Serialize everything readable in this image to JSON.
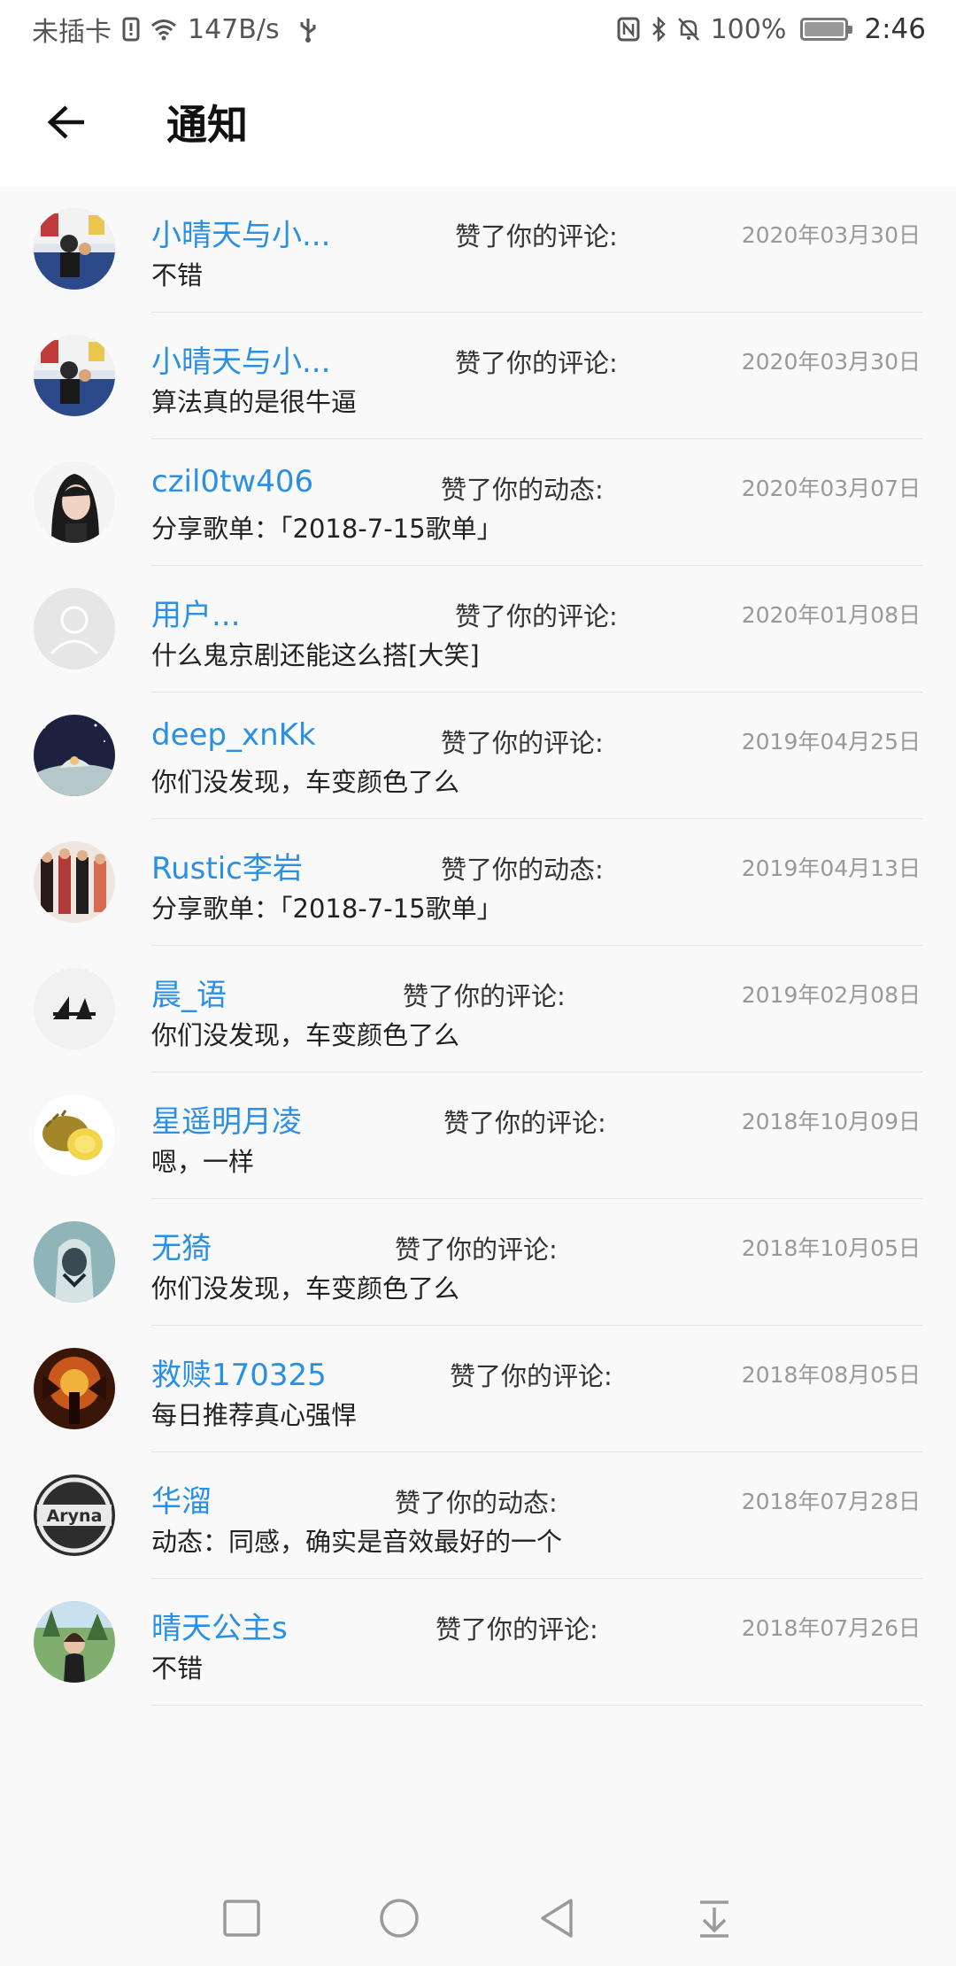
{
  "status_bar": {
    "carrier": "未插卡",
    "speed": "147B/s",
    "battery": "100%",
    "time": "2:46",
    "icons": [
      "sim-alert-icon",
      "wifi-icon",
      "usb-icon",
      "nfc-icon",
      "bluetooth-icon",
      "mute-icon",
      "battery-icon"
    ]
  },
  "header": {
    "title": "通知",
    "back_icon": "arrow-left-icon"
  },
  "notifications": [
    {
      "name": "小晴天与小...",
      "action": "赞了你的评论:",
      "date": "2020年03月30日",
      "content": "不错",
      "avatar": "photo"
    },
    {
      "name": "小晴天与小...",
      "action": "赞了你的评论:",
      "date": "2020年03月30日",
      "content": "算法真的是很牛逼",
      "avatar": "photo"
    },
    {
      "name": "czil0tw406",
      "action": "赞了你的动态:",
      "date": "2020年03月07日",
      "content": "分享歌单：「2018-7-15歌单」",
      "avatar": "photo"
    },
    {
      "name": "用户...",
      "action": "赞了你的评论:",
      "date": "2020年01月08日",
      "content": "什么鬼京剧还能这么搭[大笑]",
      "avatar": "default"
    },
    {
      "name": "deep_xnKk",
      "action": "赞了你的评论:",
      "date": "2019年04月25日",
      "content": "你们没发现，车变颜色了么",
      "avatar": "photo"
    },
    {
      "name": "Rustic李岩",
      "action": "赞了你的动态:",
      "date": "2019年04月13日",
      "content": "分享歌单：「2018-7-15歌单」",
      "avatar": "photo"
    },
    {
      "name": "晨_语",
      "action": "赞了你的评论:",
      "date": "2019年02月08日",
      "content": "你们没发现，车变颜色了么",
      "avatar": "logo"
    },
    {
      "name": "星遥明月凌",
      "action": "赞了你的评论:",
      "date": "2018年10月09日",
      "content": "嗯，一样",
      "avatar": "photo"
    },
    {
      "name": "无猗",
      "action": "赞了你的评论:",
      "date": "2018年10月05日",
      "content": "你们没发现，车变颜色了么",
      "avatar": "photo"
    },
    {
      "name": "救赎170325",
      "action": "赞了你的评论:",
      "date": "2018年08月05日",
      "content": "每日推荐真心强悍",
      "avatar": "photo"
    },
    {
      "name": "华溜",
      "action": "赞了你的动态:",
      "date": "2018年07月28日",
      "content": "动态：同感，确实是音效最好的一个",
      "avatar": "logo-text",
      "avatar_text": "Aryna"
    },
    {
      "name": "晴天公主s",
      "action": "赞了你的评论:",
      "date": "2018年07月26日",
      "content": "不错",
      "avatar": "photo"
    }
  ],
  "nav_bar": {
    "icons": [
      "square-icon",
      "circle-icon",
      "triangle-back-icon",
      "pull-down-icon"
    ]
  }
}
